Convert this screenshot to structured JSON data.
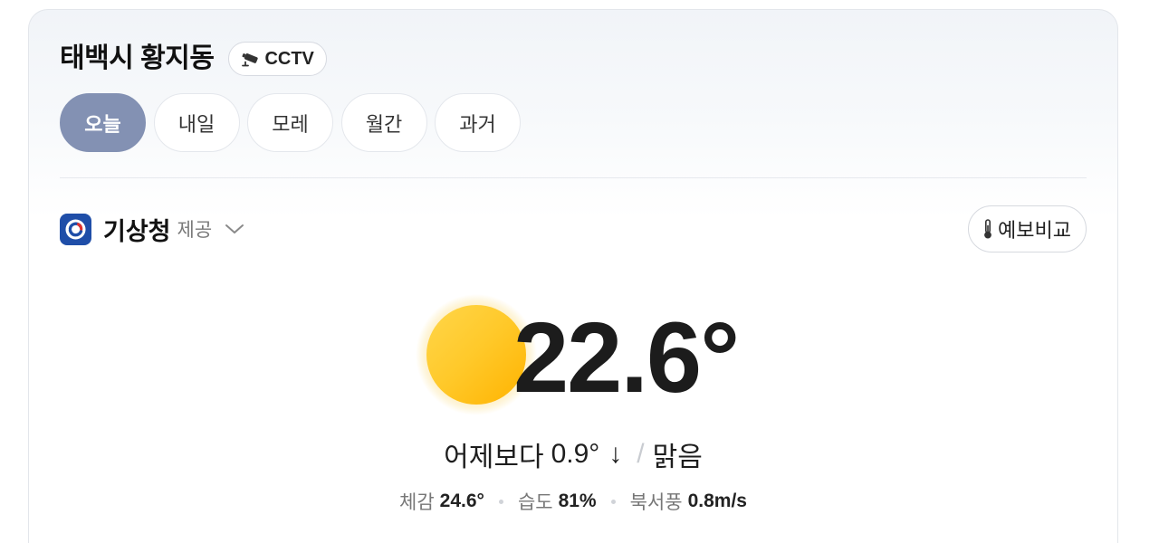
{
  "location": {
    "name": "태백시 황지동"
  },
  "cctv": {
    "label": "CCTV",
    "icon": "cctv-camera-icon"
  },
  "tabs": [
    {
      "label": "오늘",
      "active": true
    },
    {
      "label": "내일",
      "active": false
    },
    {
      "label": "모레",
      "active": false
    },
    {
      "label": "월간",
      "active": false
    },
    {
      "label": "과거",
      "active": false
    }
  ],
  "provider": {
    "name": "기상청",
    "suffix": "제공",
    "logo_icon": "kma-logo-icon",
    "dropdown_icon": "chevron-down-icon"
  },
  "compare_button": {
    "label": "예보비교",
    "icon": "thermometer-icon"
  },
  "current": {
    "weather_icon": "sun-icon",
    "temperature": "22.6°",
    "yesterday_label": "어제보다",
    "yesterday_diff": "0.9°",
    "trend_arrow": "↓",
    "separator": "/",
    "condition": "맑음"
  },
  "details": [
    {
      "label": "체감",
      "value": "24.6°"
    },
    {
      "label": "습도",
      "value": "81%"
    },
    {
      "label": "북서풍",
      "value": "0.8m/s"
    }
  ],
  "colors": {
    "active_tab": "#8391b3",
    "sun_light": "#ffd64a",
    "sun_dark": "#ffb300",
    "kma_blue": "#1f4ea8"
  }
}
